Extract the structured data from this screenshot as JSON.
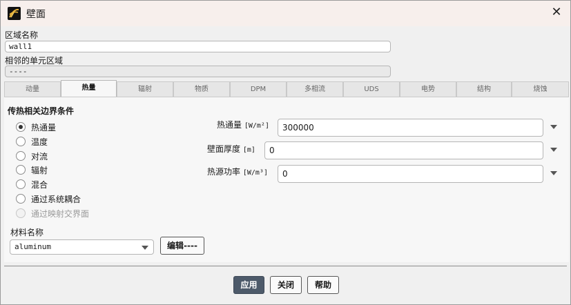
{
  "window": {
    "title": "壁面",
    "close_symbol": "✕"
  },
  "zone": {
    "name_label": "区域名称",
    "name_value": "wall1",
    "adjacent_label": "相邻的单元区域",
    "adjacent_value": "----"
  },
  "tabs": [
    {
      "label": "动量",
      "active": false
    },
    {
      "label": "热量",
      "active": true
    },
    {
      "label": "辐射",
      "active": false
    },
    {
      "label": "物质",
      "active": false
    },
    {
      "label": "DPM",
      "active": false
    },
    {
      "label": "多相流",
      "active": false
    },
    {
      "label": "UDS",
      "active": false
    },
    {
      "label": "电势",
      "active": false
    },
    {
      "label": "结构",
      "active": false
    },
    {
      "label": "烧蚀",
      "active": false
    }
  ],
  "thermal": {
    "group_title": "传热相关边界条件",
    "options": [
      {
        "label": "热通量",
        "checked": true,
        "disabled": false
      },
      {
        "label": "温度",
        "checked": false,
        "disabled": false
      },
      {
        "label": "对流",
        "checked": false,
        "disabled": false
      },
      {
        "label": "辐射",
        "checked": false,
        "disabled": false
      },
      {
        "label": "混合",
        "checked": false,
        "disabled": false
      },
      {
        "label": "通过系统耦合",
        "checked": false,
        "disabled": false
      },
      {
        "label": "通过映射交界面",
        "checked": false,
        "disabled": true
      }
    ],
    "properties": [
      {
        "label": "热通量",
        "unit": "[W/m²]",
        "value": "300000"
      },
      {
        "label": "壁面厚度",
        "unit": "[m]",
        "value": "0"
      },
      {
        "label": "热源功率",
        "unit": "[W/m³]",
        "value": "0"
      }
    ]
  },
  "material": {
    "label": "材料名称",
    "value": "aluminum",
    "edit_label": "编辑----"
  },
  "buttons": {
    "apply": "应用",
    "close": "关闭",
    "help": "帮助"
  }
}
